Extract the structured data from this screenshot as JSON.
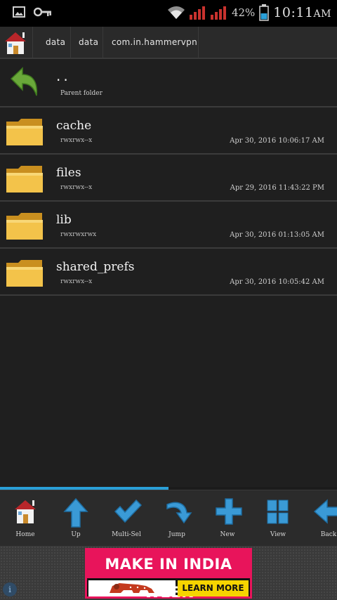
{
  "status_bar": {
    "battery_percent": "42%",
    "time": "10:11",
    "time_suffix": "AM"
  },
  "breadcrumb": {
    "items": [
      "data",
      "data",
      "com.in.hammervpn"
    ]
  },
  "parent_row": {
    "name": "..",
    "subtitle": "Parent folder"
  },
  "files": [
    {
      "name": "cache",
      "perm": "rwxrwx--x",
      "date": "Apr 30, 2016 10:06:17 AM"
    },
    {
      "name": "files",
      "perm": "rwxrwx--x",
      "date": "Apr 29, 2016 11:43:22 PM"
    },
    {
      "name": "lib",
      "perm": "rwxrwxrwx",
      "date": "Apr 30, 2016 01:13:05 AM"
    },
    {
      "name": "shared_prefs",
      "perm": "rwxrwx--x",
      "date": "Apr 30, 2016 10:05:42 AM"
    }
  ],
  "toolbar": {
    "home_label": "Home",
    "up_label": "Up",
    "multisel_label": "Multi-Sel",
    "jump_label": "Jump",
    "new_label": "New",
    "view_label": "View",
    "back_label": "Back"
  },
  "ad": {
    "title": "MAKE IN INDIA WEEK",
    "cta": "LEARN MORE",
    "info_glyph": "i"
  },
  "colors": {
    "accent_blue": "#2a9fd8",
    "folder_yellow": "#f3c34a",
    "ad_pink": "#e8145b",
    "ad_yellow": "#f6d400"
  }
}
